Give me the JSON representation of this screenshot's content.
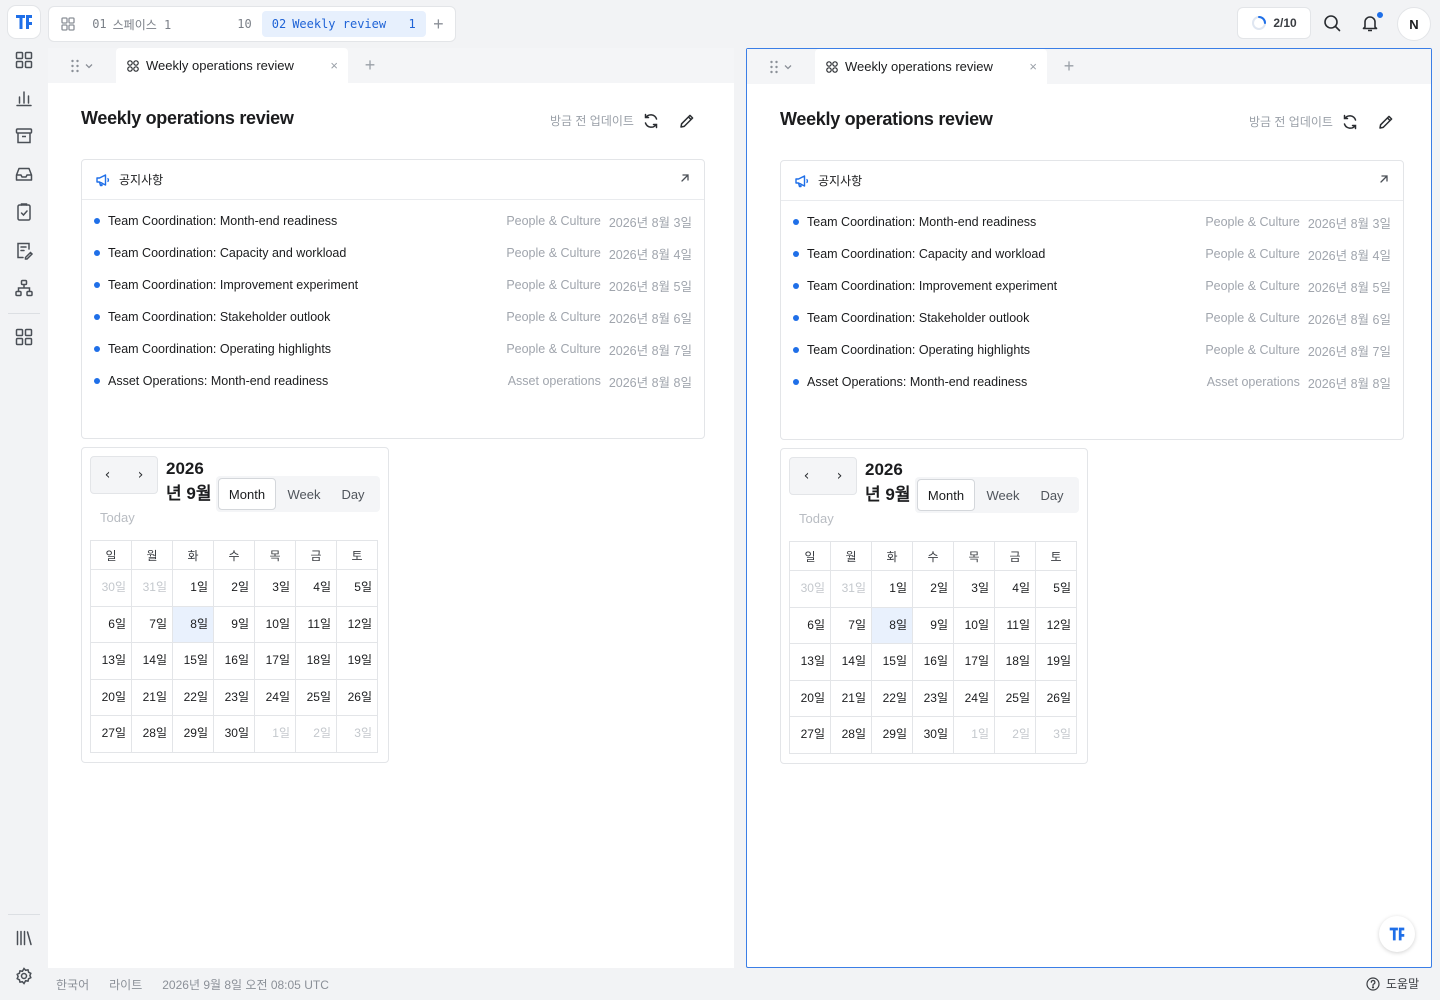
{
  "app": {
    "brand_color": "#1f6fe8"
  },
  "rail": {
    "logo": "app-logo",
    "items": [
      "dashboard-icon",
      "chart-icon",
      "archive-icon",
      "inbox-icon",
      "task-check-icon",
      "document-edit-icon",
      "org-chart-icon",
      "apps-grid-icon"
    ],
    "bottom": [
      "library-icon",
      "settings-icon"
    ]
  },
  "spaces": {
    "tabs": [
      {
        "num": "01",
        "label": "스페이스 1",
        "count": "10"
      },
      {
        "num": "02",
        "label": "Weekly review",
        "count": "1"
      }
    ]
  },
  "topbar": {
    "progress": "2/10",
    "avatar": "N"
  },
  "panel": {
    "tab_label": "Weekly operations review",
    "title": "Weekly operations review",
    "update_label": "방금 전 업데이트",
    "notice": {
      "title": "공지사항",
      "items": [
        {
          "title": "Team Coordination: Month-end readiness",
          "category": "People & Culture",
          "date": "2026년 8월 3일"
        },
        {
          "title": "Team Coordination: Capacity and workload",
          "category": "People & Culture",
          "date": "2026년 8월 4일"
        },
        {
          "title": "Team Coordination: Improvement experiment",
          "category": "People & Culture",
          "date": "2026년 8월 5일"
        },
        {
          "title": "Team Coordination: Stakeholder outlook",
          "category": "People & Culture",
          "date": "2026년 8월 6일"
        },
        {
          "title": "Team Coordination: Operating highlights",
          "category": "People & Culture",
          "date": "2026년 8월 7일"
        },
        {
          "title": "Asset Operations: Month-end readiness",
          "category": "Asset operations",
          "date": "2026년 8월 8일"
        }
      ]
    },
    "calendar": {
      "prev": "‹",
      "next": "›",
      "today_label": "Today",
      "title": "2026년 9월",
      "views": {
        "month": "Month",
        "week": "Week",
        "day": "Day"
      },
      "weekdays": [
        "일",
        "월",
        "화",
        "수",
        "목",
        "금",
        "토"
      ],
      "weeks": [
        [
          "30일",
          "31일",
          "1일",
          "2일",
          "3일",
          "4일",
          "5일"
        ],
        [
          "6일",
          "7일",
          "8일",
          "9일",
          "10일",
          "11일",
          "12일"
        ],
        [
          "13일",
          "14일",
          "15일",
          "16일",
          "17일",
          "18일",
          "19일"
        ],
        [
          "20일",
          "21일",
          "22일",
          "23일",
          "24일",
          "25일",
          "26일"
        ],
        [
          "27일",
          "28일",
          "29일",
          "30일",
          "1일",
          "2일",
          "3일"
        ]
      ]
    }
  },
  "footer": {
    "language": "한국어",
    "theme": "라이트",
    "datetime": "2026년 9월 8일 오전 08:05 UTC",
    "help": "도움말"
  }
}
